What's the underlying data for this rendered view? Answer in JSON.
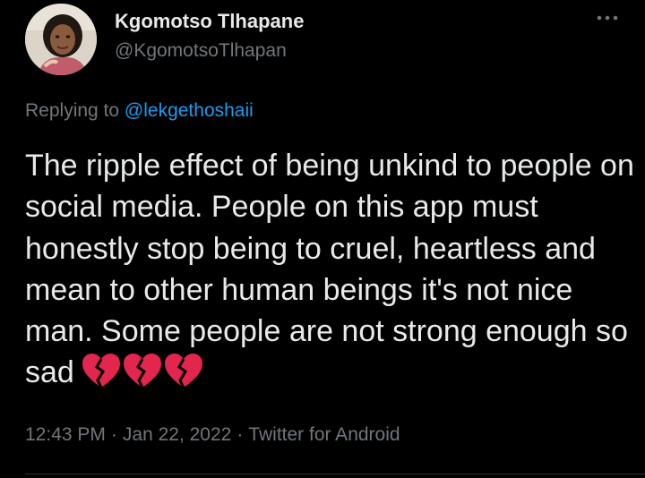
{
  "tweet": {
    "author_name": "Kgomotso Tlhapane",
    "author_handle": "@KgomotsoTlhapan",
    "more_icon": "more-horizontal-icon",
    "replying_prefix": "Replying to",
    "replying_to": "@lekgethoshaii",
    "text": "The ripple effect of being unkind to people on social media. People on this app must honestly stop being to cruel, heartless and mean to other human beings it's not nice man. Some people are not strong enough so sad",
    "emojis": [
      "broken-heart-icon",
      "broken-heart-icon",
      "broken-heart-icon"
    ],
    "time": "12:43 PM",
    "separator": "·",
    "date": "Jan 22, 2022",
    "source": "Twitter for Android"
  },
  "colors": {
    "background": "#000000",
    "primary_text": "#e7e9ea",
    "secondary_text": "#71767b",
    "link": "#1d9bf0",
    "heart": "#e2264d",
    "divider": "#2f3336"
  }
}
